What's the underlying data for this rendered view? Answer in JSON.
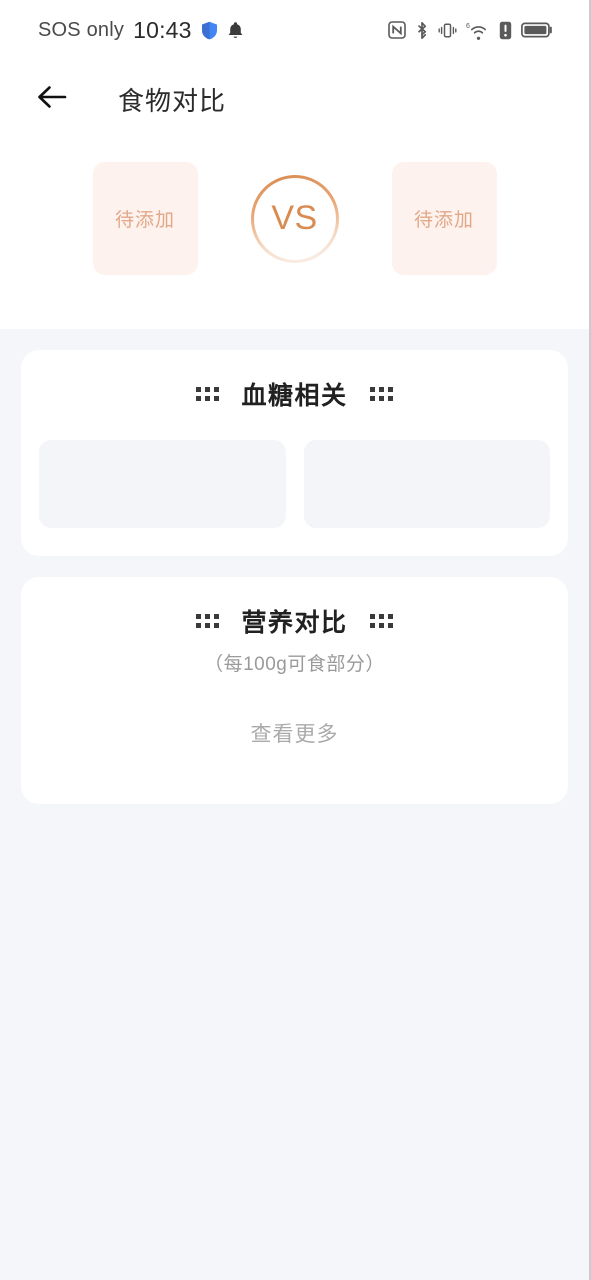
{
  "statusbar": {
    "carrier": "SOS only",
    "time": "10:43",
    "icons_left": [
      "shield-icon",
      "bell-icon"
    ],
    "icons_right": [
      "nfc-icon",
      "bluetooth-icon",
      "vibrate-icon",
      "wifi-6-icon",
      "alert-icon",
      "battery-icon"
    ],
    "wifi_badge": "6"
  },
  "header": {
    "back_icon": "back-arrow-icon",
    "title": "食物对比"
  },
  "compare": {
    "left_slot_label": "待添加",
    "right_slot_label": "待添加",
    "vs_label": "VS"
  },
  "cards": [
    {
      "id": "blood-glucose",
      "title": "血糖相关",
      "subtitle": "",
      "placeholders": 2,
      "more_label": ""
    },
    {
      "id": "nutrition",
      "title": "营养对比",
      "subtitle": "（每100g可食部分）",
      "placeholders": 0,
      "more_label": "查看更多"
    }
  ],
  "colors": {
    "page_bg": "#F5F6FA",
    "card_bg": "#FFFFFF",
    "accent_orange": "#D98C52",
    "slot_bg": "#FDF2ED",
    "slot_text": "#E2A888",
    "placeholder_bg": "#F4F5F9",
    "title_text": "#212121",
    "muted_text": "#9A9A9A"
  }
}
